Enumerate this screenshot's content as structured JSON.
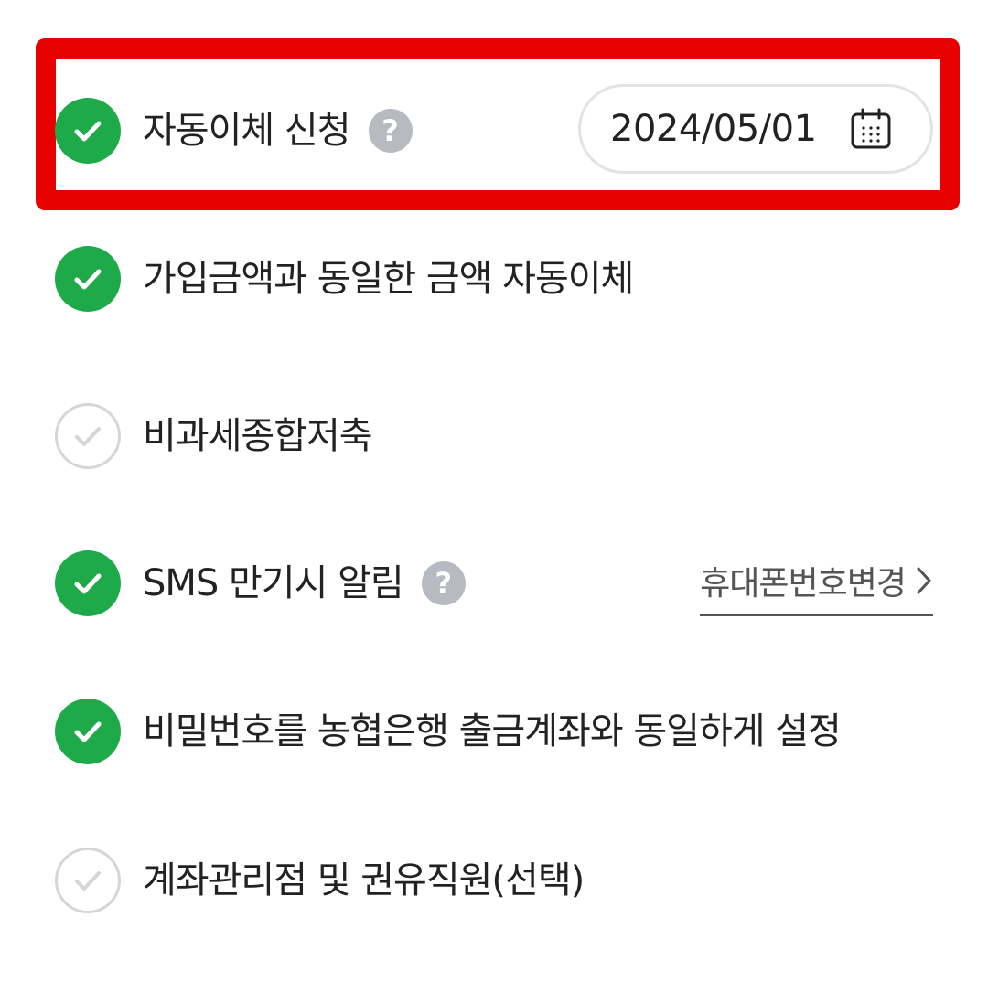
{
  "options": [
    {
      "label": "자동이체 신청",
      "checked": true,
      "help": "?",
      "date": "2024/05/01"
    },
    {
      "label": "가입금액과 동일한 금액 자동이체",
      "checked": true
    },
    {
      "label": "비과세종합저축",
      "checked": false
    },
    {
      "label": "SMS 만기시 알림",
      "checked": true,
      "help": "?",
      "link": "휴대폰번호변경"
    },
    {
      "label": "비밀번호를 농협은행 출금계좌와 동일하게 설정",
      "checked": true
    },
    {
      "label": "계좌관리점 및 권유직원(선택)",
      "checked": false
    }
  ],
  "icons": {
    "checked": "checkmark-filled-icon",
    "unchecked": "checkmark-outline-icon",
    "help": "question-circle-icon",
    "calendar": "calendar-icon",
    "chevron": "chevron-right-icon"
  },
  "colors": {
    "checked_fill": "#1faa4a",
    "unchecked_border": "#d6d6d6",
    "help_bg": "#b7bac1",
    "highlight": "#e60000",
    "link_text": "#555555"
  }
}
